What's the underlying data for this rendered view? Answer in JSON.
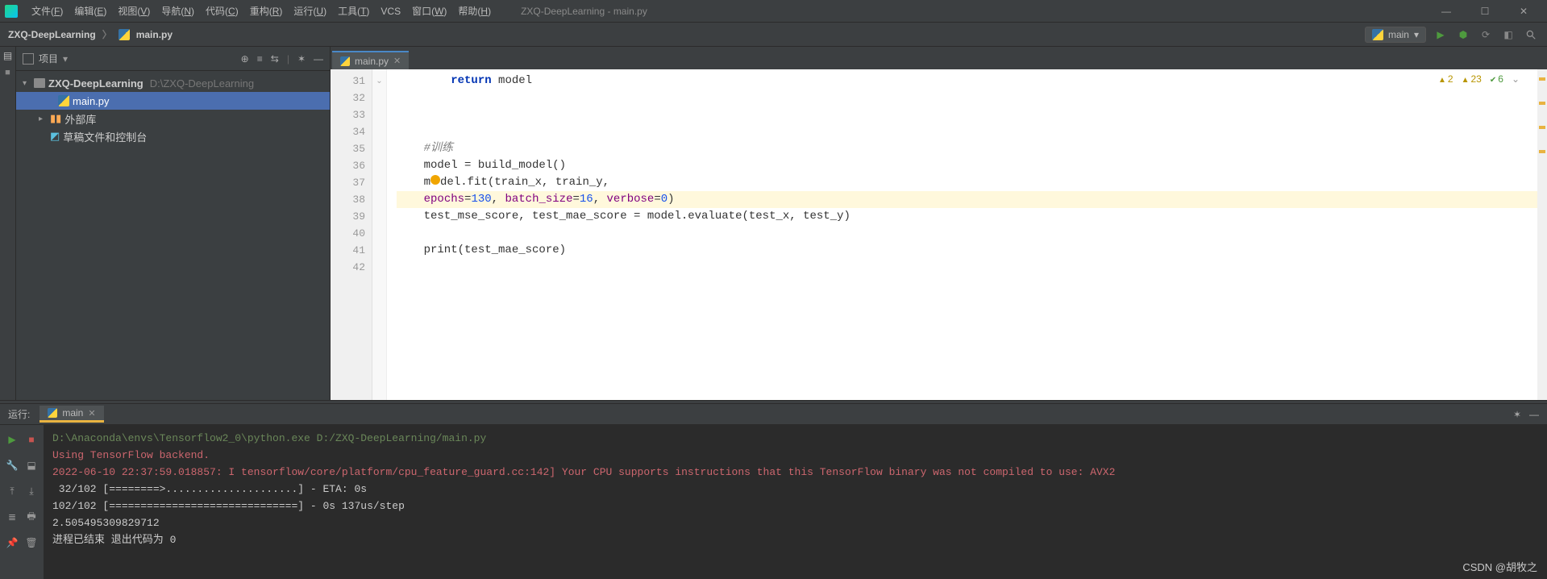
{
  "titlebar": {
    "menus": [
      "文件(F)",
      "编辑(E)",
      "视图(V)",
      "导航(N)",
      "代码(C)",
      "重构(R)",
      "运行(U)",
      "工具(T)",
      "VCS",
      "窗口(W)",
      "帮助(H)"
    ],
    "title": "ZXQ-DeepLearning - main.py"
  },
  "breadcrumb": {
    "project": "ZXQ-DeepLearning",
    "file": "main.py"
  },
  "run_config": {
    "name": "main",
    "dropdown": "▾"
  },
  "project_panel": {
    "title": "项目",
    "root": {
      "name": "ZXQ-DeepLearning",
      "path": "D:\\ZXQ-DeepLearning"
    },
    "file": "main.py",
    "ext_lib": "外部库",
    "scratches": "草稿文件和控制台"
  },
  "editor": {
    "tab": "main.py",
    "line_start": 31,
    "lines": [
      {
        "n": 31,
        "fold": "⌄",
        "html": "        <span class='kw2'>return</span> model"
      },
      {
        "n": 32,
        "html": ""
      },
      {
        "n": 33,
        "html": ""
      },
      {
        "n": 34,
        "html": ""
      },
      {
        "n": 35,
        "html": "    <span class='cm'>#训练</span>"
      },
      {
        "n": 36,
        "html": "    model = build_model()"
      },
      {
        "n": 37,
        "html": "    m<span class='bulb'></span>del.fit(train_x, train_y,"
      },
      {
        "n": 38,
        "hl": true,
        "html": "    <span class='arg'>epochs</span>=<span class='num'>130</span>, <span class='arg'>batch_size</span>=<span class='num'>16</span>, <span class='arg'>verbose</span>=<span class='num'>0</span>)"
      },
      {
        "n": 39,
        "html": "    test_mse_score, test_mae_score = model.evaluate(test_x, test_y)"
      },
      {
        "n": 40,
        "html": ""
      },
      {
        "n": 41,
        "html": "    print(test_mae_score)"
      },
      {
        "n": 42,
        "html": ""
      }
    ],
    "inspections": {
      "warn1": "2",
      "warn2": "23",
      "ok": "6"
    }
  },
  "console": {
    "label": "运行:",
    "tab": "main",
    "lines": [
      {
        "cls": "path",
        "t": "D:\\Anaconda\\envs\\Tensorflow2_0\\python.exe D:/ZXQ-DeepLearning/main.py"
      },
      {
        "cls": "err",
        "t": "Using TensorFlow backend."
      },
      {
        "cls": "info",
        "t": "2022-06-10 22:37:59.018857: I tensorflow/core/platform/cpu_feature_guard.cc:142] Your CPU supports instructions that this TensorFlow binary was not compiled to use: AVX2"
      },
      {
        "cls": "",
        "t": ""
      },
      {
        "cls": "",
        "t": " 32/102 [========>.....................] - ETA: 0s"
      },
      {
        "cls": "",
        "t": "102/102 [==============================] - 0s 137us/step"
      },
      {
        "cls": "",
        "t": "2.505495309829712"
      },
      {
        "cls": "",
        "t": ""
      },
      {
        "cls": "",
        "t": "进程已结束 退出代码为 0"
      }
    ]
  },
  "watermark": "CSDN @胡牧之"
}
